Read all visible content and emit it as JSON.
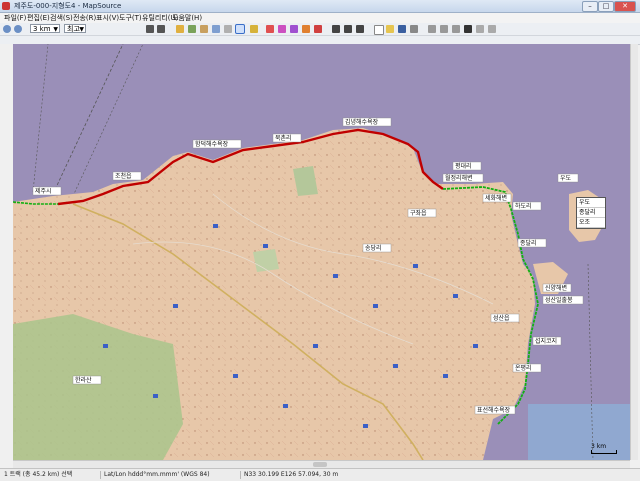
{
  "window": {
    "title": "제주도-000-지형도4 - MapSource",
    "min_glyph": "–",
    "max_glyph": "□",
    "close_glyph": "✕"
  },
  "menu": [
    "파일(F)",
    "편집(E)",
    "검색(S)",
    "전송(R)",
    "표시(V)",
    "도구(T)",
    "유틸리티(U)",
    "도움말(H)"
  ],
  "toolbar": {
    "zoom_value": "3 km",
    "detail_value": "최고"
  },
  "map": {
    "labels": [
      {
        "text": "한라산"
      },
      {
        "text": "제주시"
      },
      {
        "text": "조천읍"
      },
      {
        "text": "함덕해수욕장"
      },
      {
        "text": "북촌리"
      },
      {
        "text": "김녕해수욕장"
      },
      {
        "text": "월정리해변"
      },
      {
        "text": "하도리"
      },
      {
        "text": "종달리"
      },
      {
        "text": "성산일출봉"
      },
      {
        "text": "우도"
      },
      {
        "text": "섭지코지"
      },
      {
        "text": "온평리"
      },
      {
        "text": "표선해수욕장"
      },
      {
        "text": "구좌읍"
      },
      {
        "text": "송당리"
      },
      {
        "text": "성산읍"
      },
      {
        "text": "세화해변"
      },
      {
        "text": "평대리"
      },
      {
        "text": "신양해변"
      }
    ],
    "legend_items": [
      "우도",
      "종달리",
      "오조"
    ],
    "scale_text": "3 km"
  },
  "statusbar": {
    "selection": "1 트랙 (총 45.2 km) 선택",
    "format": "Lat/Lon hddd°mm.mmm' (WGS 84)",
    "coords": "N33 30.199 E126 57.094, 30 m"
  }
}
